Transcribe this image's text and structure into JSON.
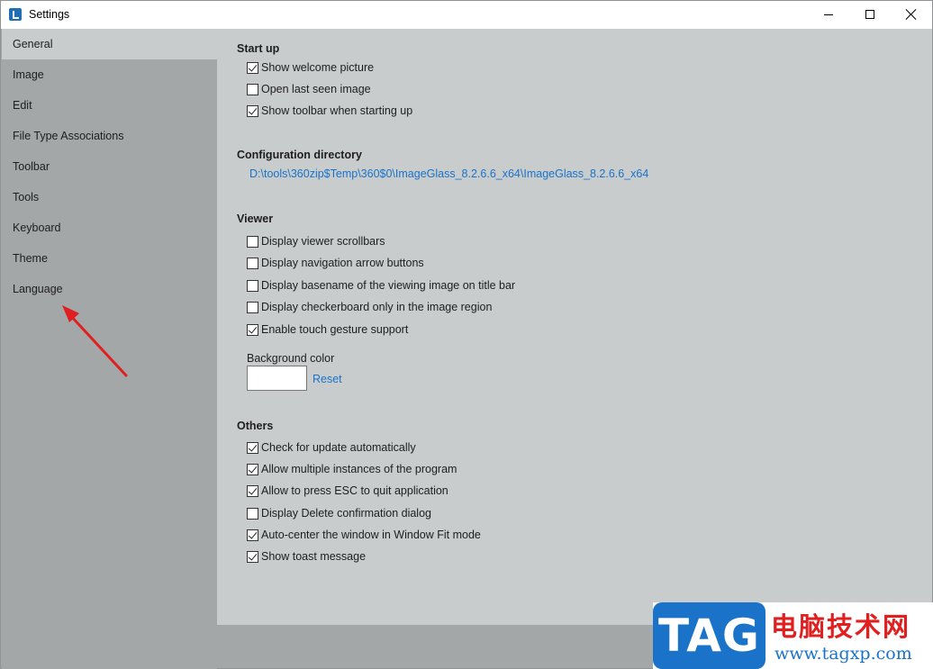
{
  "window": {
    "title": "Settings"
  },
  "sidebar": {
    "items": [
      {
        "label": "General",
        "active": true
      },
      {
        "label": "Image"
      },
      {
        "label": "Edit"
      },
      {
        "label": "File Type Associations"
      },
      {
        "label": "Toolbar"
      },
      {
        "label": "Tools"
      },
      {
        "label": "Keyboard"
      },
      {
        "label": "Theme"
      },
      {
        "label": "Language"
      }
    ]
  },
  "general": {
    "startup": {
      "title": "Start up",
      "options": [
        {
          "label": "Show welcome picture",
          "checked": true
        },
        {
          "label": "Open last seen image",
          "checked": false
        },
        {
          "label": "Show toolbar when starting up",
          "checked": true
        }
      ]
    },
    "config": {
      "title": "Configuration directory",
      "path": "D:\\tools\\360zip$Temp\\360$0\\ImageGlass_8.2.6.6_x64\\ImageGlass_8.2.6.6_x64"
    },
    "viewer": {
      "title": "Viewer",
      "options": [
        {
          "label": "Display viewer scrollbars",
          "checked": false
        },
        {
          "label": "Display navigation arrow buttons",
          "checked": false
        },
        {
          "label": "Display basename of the viewing image on title bar",
          "checked": false
        },
        {
          "label": "Display checkerboard only in the image region",
          "checked": false
        },
        {
          "label": "Enable touch gesture support",
          "checked": true
        }
      ],
      "background_color_label": "Background color",
      "background_color_value": "#ffffff",
      "reset_label": "Reset"
    },
    "others": {
      "title": "Others",
      "options": [
        {
          "label": "Check for update automatically",
          "checked": true
        },
        {
          "label": "Allow multiple instances of the program",
          "checked": true
        },
        {
          "label": "Allow to press ESC to quit application",
          "checked": true
        },
        {
          "label": "Display Delete confirmation dialog",
          "checked": false
        },
        {
          "label": "Auto-center the window in Window Fit mode",
          "checked": true
        },
        {
          "label": "Show toast message",
          "checked": true
        }
      ]
    }
  },
  "watermark": {
    "badge": "TAG",
    "cn_text": "电脑技术网",
    "url": "www.tagxp.com"
  },
  "colors": {
    "sidebar_bg": "#a3a7a8",
    "content_bg": "#c8cccd",
    "link": "#1a73c9",
    "arrow": "#e02020",
    "watermark_blue": "#1b73c9",
    "watermark_red": "#e02020"
  }
}
